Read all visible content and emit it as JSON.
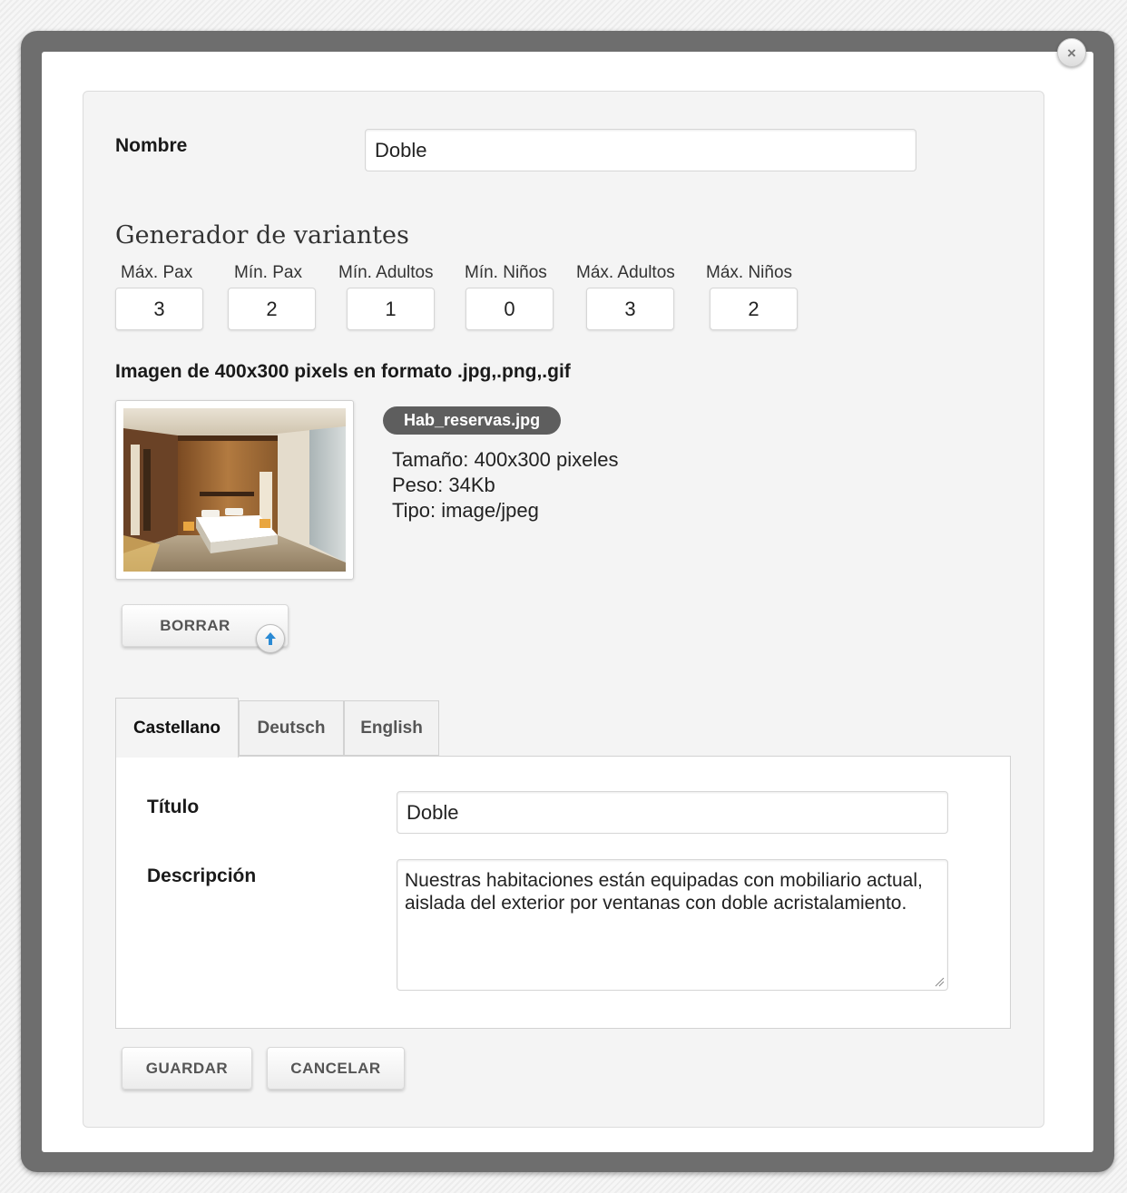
{
  "modal": {
    "close_glyph": "×"
  },
  "form": {
    "nombre_label": "Nombre",
    "nombre_value": "Doble"
  },
  "variants": {
    "title": "Generador de variantes",
    "fields": [
      {
        "label": "Máx. Pax",
        "value": "3"
      },
      {
        "label": "Mín. Pax",
        "value": "2"
      },
      {
        "label": "Mín. Adultos",
        "value": "1"
      },
      {
        "label": "Mín. Niños",
        "value": "0"
      },
      {
        "label": "Máx. Adultos",
        "value": "3"
      },
      {
        "label": "Máx. Niños",
        "value": "2"
      }
    ]
  },
  "image": {
    "title": "Imagen de 400x300 pixels en formato .jpg,.png,.gif",
    "filename": "Hab_reservas.jpg",
    "size": "Tamaño: 400x300 pixeles",
    "weight": "Peso: 34Kb",
    "type": "Tipo: image/jpeg",
    "delete_label": "BORRAR"
  },
  "tabs": [
    {
      "label": "Castellano",
      "active": true
    },
    {
      "label": "Deutsch",
      "active": false
    },
    {
      "label": "English",
      "active": false
    }
  ],
  "content": {
    "titulo_label": "Título",
    "titulo_value": "Doble",
    "descripcion_label": "Descripción",
    "descripcion_value": "Nuestras habitaciones están equipadas con mobiliario actual, aislada del exterior por ventanas con doble acristalamiento."
  },
  "actions": {
    "save_label": "GUARDAR",
    "cancel_label": "CANCELAR"
  },
  "icons": {
    "close": "close-icon",
    "upload": "upload-arrow-icon"
  },
  "colors": {
    "frame": "#6e6e6e",
    "panel": "#f4f4f4",
    "pill": "#5e5e5e",
    "upload_arrow": "#2a8ad4"
  }
}
